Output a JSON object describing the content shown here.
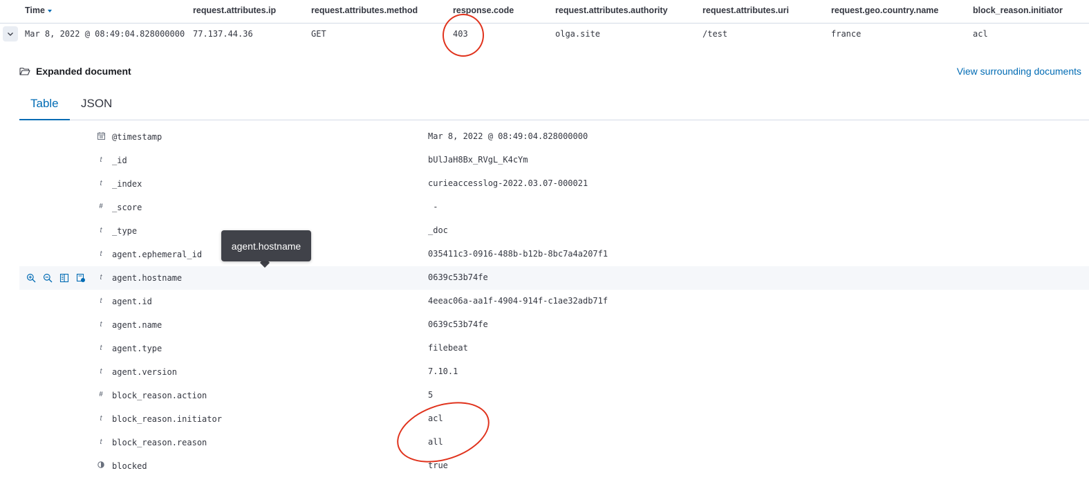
{
  "columns": [
    {
      "label": "Time",
      "sorted": true
    },
    {
      "label": "request.attributes.ip"
    },
    {
      "label": "request.attributes.method"
    },
    {
      "label": "response.code"
    },
    {
      "label": "request.attributes.authority"
    },
    {
      "label": "request.attributes.uri"
    },
    {
      "label": "request.geo.country.name"
    },
    {
      "label": "block_reason.initiator"
    }
  ],
  "row": [
    "Mar 8, 2022 @ 08:49:04.828000000",
    "77.137.44.36",
    "GET",
    "403",
    "olga.site",
    "/test",
    "france",
    "acl"
  ],
  "expanded": {
    "title": "Expanded document",
    "view_surrounding": "View surrounding documents"
  },
  "tabs": [
    "Table",
    "JSON"
  ],
  "fields": [
    {
      "type": "date",
      "type_glyph": "",
      "name": "@timestamp",
      "value": "Mar 8, 2022 @ 08:49:04.828000000"
    },
    {
      "type": "string",
      "type_glyph": "t",
      "name": "_id",
      "value": "bUlJaH8Bx_RVgL_K4cYm"
    },
    {
      "type": "string",
      "type_glyph": "t",
      "name": "_index",
      "value": "curieaccesslog-2022.03.07-000021"
    },
    {
      "type": "number",
      "type_glyph": "#",
      "name": "_score",
      "value": " -"
    },
    {
      "type": "string",
      "type_glyph": "t",
      "name": "_type",
      "value": "_doc"
    },
    {
      "type": "string",
      "type_glyph": "t",
      "name": "agent.ephemeral_id",
      "value": "035411c3-0916-488b-b12b-8bc7a4a207f1"
    },
    {
      "type": "string",
      "type_glyph": "t",
      "name": "agent.hostname",
      "value": "0639c53b74fe"
    },
    {
      "type": "string",
      "type_glyph": "t",
      "name": "agent.id",
      "value": "4eeac06a-aa1f-4904-914f-c1ae32adb71f"
    },
    {
      "type": "string",
      "type_glyph": "t",
      "name": "agent.name",
      "value": "0639c53b74fe"
    },
    {
      "type": "string",
      "type_glyph": "t",
      "name": "agent.type",
      "value": "filebeat"
    },
    {
      "type": "string",
      "type_glyph": "t",
      "name": "agent.version",
      "value": "7.10.1"
    },
    {
      "type": "number",
      "type_glyph": "#",
      "name": "block_reason.action",
      "value": "5"
    },
    {
      "type": "string",
      "type_glyph": "t",
      "name": "block_reason.initiator",
      "value": "acl"
    },
    {
      "type": "string",
      "type_glyph": "t",
      "name": "block_reason.reason",
      "value": "all"
    },
    {
      "type": "boolean",
      "type_glyph": "",
      "name": "blocked",
      "value": "true"
    }
  ],
  "tooltip": "agent.hostname",
  "colors": {
    "accent": "#006bb4",
    "annotation": "#e0321c",
    "tooltip_bg": "#404249"
  }
}
